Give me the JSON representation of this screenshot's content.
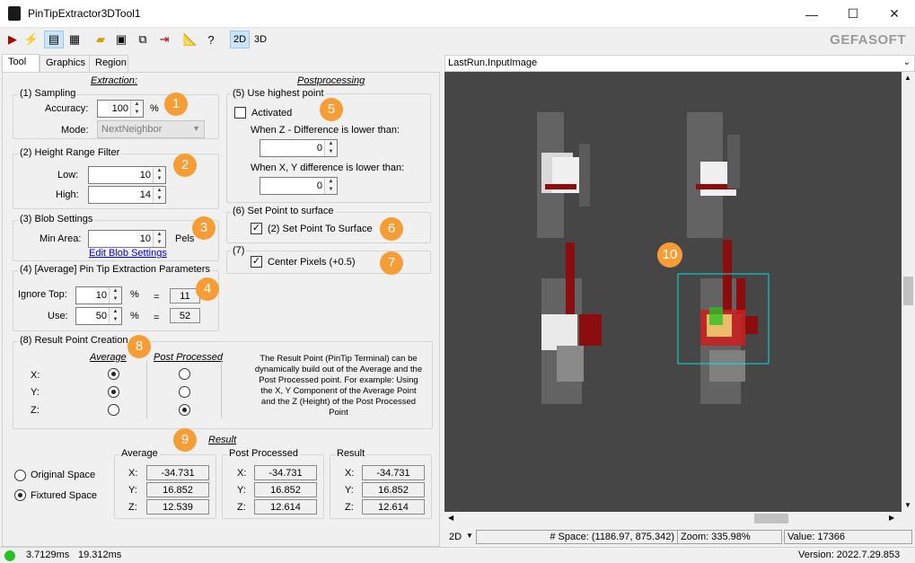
{
  "window": {
    "title": "PinTipExtractor3DTool1",
    "minimize": "—",
    "maximize": "☐",
    "close": "✕"
  },
  "toolbar": {
    "mode2d": "2D",
    "mode3d": "3D",
    "logo": "GEFASOFT"
  },
  "tabs": [
    "Tool",
    "Graphics",
    "Region"
  ],
  "extraction": {
    "heading": "Extraction:",
    "sampling": {
      "label": "(1) Sampling",
      "accuracy_label": "Accuracy:",
      "accuracy": "100",
      "accuracy_unit": "%",
      "mode_label": "Mode:",
      "mode": "NextNeighbor"
    },
    "height": {
      "label": "(2) Height Range Filter",
      "low_label": "Low:",
      "low": "10",
      "high_label": "High:",
      "high": "14"
    },
    "blob": {
      "label": "(3) Blob Settings",
      "min_area_label": "Min Area:",
      "min_area": "10",
      "unit": "Pels",
      "edit_link": "Edit Blob Settings"
    },
    "avg": {
      "label": "(4) [Average] Pin Tip Extraction Parameters",
      "ignore_label": "Ignore Top:",
      "ignore": "10",
      "use_label": "Use:",
      "use": "50",
      "pct": "%",
      "eq": "=",
      "ignore_result": "11",
      "use_result": "52"
    }
  },
  "post": {
    "heading": "Postprocessing",
    "highest": {
      "label": "(5) Use highest point",
      "activated": "Activated",
      "z_label": "When Z - Difference is lower than:",
      "z_value": "0",
      "xy_label": "When X, Y difference is lower than:",
      "xy_value": "0"
    },
    "surface": {
      "label": "(6) Set Point to surface",
      "check": "(2) Set Point To Surface"
    },
    "center": {
      "label": "(7)",
      "check": "Center Pixels (+0.5)"
    }
  },
  "creation": {
    "label": "(8) Result Point Creation",
    "col_avg": "Average",
    "col_post": "Post Processed",
    "rows": [
      "X:",
      "Y:",
      "Z:"
    ],
    "avg_selected": [
      true,
      true,
      false
    ],
    "post_selected": [
      false,
      false,
      true
    ],
    "note": "The Result Point (PinTip Terminal) can be dynamically build out of the Average and the Post Processed point. For example: Using the X, Y Component of the Average Point and the Z (Height) of the Post Processed Point"
  },
  "result": {
    "heading": "Result",
    "space": {
      "original": "Original Space",
      "fixtured": "Fixtured Space",
      "selected": "fixtured"
    },
    "groups": [
      {
        "title": "Average",
        "x": "-34.731",
        "y": "16.852",
        "z": "12.539"
      },
      {
        "title": "Post Processed",
        "x": "-34.731",
        "y": "16.852",
        "z": "12.614"
      },
      {
        "title": "Result",
        "x": "-34.731",
        "y": "16.852",
        "z": "12.614"
      }
    ],
    "axis": [
      "X:",
      "Y:",
      "Z:"
    ]
  },
  "badges": [
    "1",
    "2",
    "3",
    "4",
    "5",
    "6",
    "7",
    "8",
    "9",
    "10"
  ],
  "viewer": {
    "source": "LastRun.InputImage",
    "mode": "2D",
    "space": "# Space: (1186.97, 875.342)",
    "zoom": "Zoom: 335.98%",
    "value": "Value: 17366"
  },
  "status": {
    "time1": "3.7129ms",
    "time2": "19.312ms",
    "version": "Version: 2022.7.29.853"
  },
  "colors": {
    "badge": "#f79d36",
    "ok": "#22c322",
    "roi": "#00e0e0",
    "pin_red": "#8b0d0d"
  }
}
